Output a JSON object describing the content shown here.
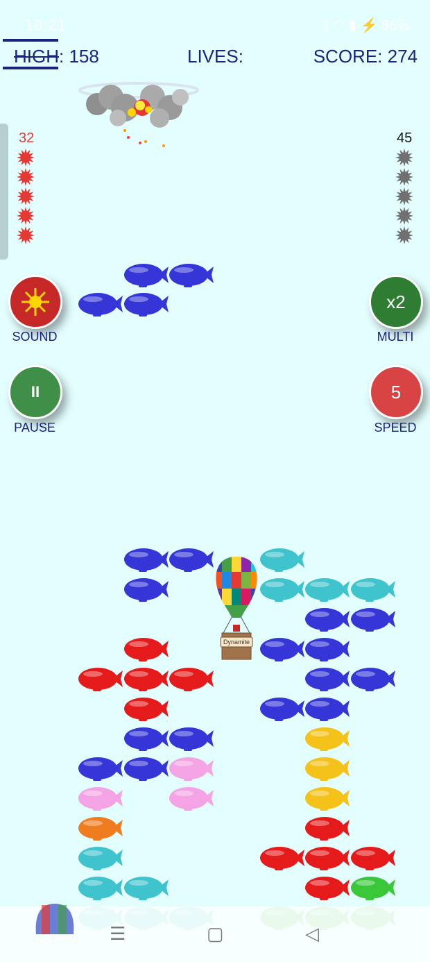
{
  "status_bar": {
    "time": "10:21",
    "battery": "86%"
  },
  "hud": {
    "high_label": "HIGH",
    "high_value": ": 158",
    "lives_label": "LIVES:",
    "score_label": "SCORE: 274"
  },
  "left_ammo": {
    "count": "32",
    "color": "#e53935"
  },
  "right_ammo": {
    "count": "45",
    "color": "#707070"
  },
  "buttons": {
    "sound": {
      "label": "SOUND",
      "color": "#c62828"
    },
    "multi": {
      "label": "MULTI",
      "text": "x2",
      "color": "#2e7d32"
    },
    "pause": {
      "label": "PAUSE",
      "text": "II",
      "color": "#3f8f48"
    },
    "speed": {
      "label": "SPEED",
      "text": "5",
      "color": "#d84343"
    }
  },
  "player": {
    "basket_label": "Dynamite"
  },
  "blimp_colors": {
    "blue": "#3535d8",
    "cyan": "#3fc3cc",
    "red": "#e51b1b",
    "pink": "#f4a3e4",
    "orange": "#f07c20",
    "yellow": "#f4c218",
    "green": "#3ac83a"
  },
  "grid_cols": [
    "c1",
    "c2",
    "c3",
    "c4",
    "c5",
    "c6",
    "c7"
  ],
  "blimps": [
    {
      "color": "blue",
      "col": 2,
      "row": 0,
      "zone": "top"
    },
    {
      "color": "blue",
      "col": 3,
      "row": 0,
      "zone": "top"
    },
    {
      "color": "blue",
      "col": 1,
      "row": 1,
      "zone": "top"
    },
    {
      "color": "blue",
      "col": 2,
      "row": 1,
      "zone": "top"
    },
    {
      "color": "blue",
      "col": 2,
      "row": 0
    },
    {
      "color": "blue",
      "col": 3,
      "row": 0
    },
    {
      "color": "cyan",
      "col": 5,
      "row": 0
    },
    {
      "color": "blue",
      "col": 2,
      "row": 1
    },
    {
      "color": "cyan",
      "col": 5,
      "row": 1
    },
    {
      "color": "cyan",
      "col": 6,
      "row": 1
    },
    {
      "color": "cyan",
      "col": 7,
      "row": 1
    },
    {
      "color": "blue",
      "col": 6,
      "row": 2
    },
    {
      "color": "blue",
      "col": 7,
      "row": 2
    },
    {
      "color": "red",
      "col": 2,
      "row": 3
    },
    {
      "color": "blue",
      "col": 5,
      "row": 3
    },
    {
      "color": "blue",
      "col": 6,
      "row": 3
    },
    {
      "color": "red",
      "col": 1,
      "row": 4
    },
    {
      "color": "red",
      "col": 2,
      "row": 4
    },
    {
      "color": "red",
      "col": 3,
      "row": 4
    },
    {
      "color": "blue",
      "col": 6,
      "row": 4
    },
    {
      "color": "blue",
      "col": 7,
      "row": 4
    },
    {
      "color": "red",
      "col": 2,
      "row": 5
    },
    {
      "color": "blue",
      "col": 5,
      "row": 5
    },
    {
      "color": "blue",
      "col": 6,
      "row": 5
    },
    {
      "color": "blue",
      "col": 2,
      "row": 6
    },
    {
      "color": "blue",
      "col": 3,
      "row": 6
    },
    {
      "color": "yellow",
      "col": 6,
      "row": 6
    },
    {
      "color": "blue",
      "col": 1,
      "row": 7
    },
    {
      "color": "blue",
      "col": 2,
      "row": 7
    },
    {
      "color": "pink",
      "col": 3,
      "row": 7
    },
    {
      "color": "yellow",
      "col": 6,
      "row": 7
    },
    {
      "color": "pink",
      "col": 1,
      "row": 8
    },
    {
      "color": "pink",
      "col": 3,
      "row": 8
    },
    {
      "color": "yellow",
      "col": 6,
      "row": 8
    },
    {
      "color": "orange",
      "col": 1,
      "row": 9
    },
    {
      "color": "red",
      "col": 6,
      "row": 9
    },
    {
      "color": "cyan",
      "col": 1,
      "row": 10
    },
    {
      "color": "red",
      "col": 5,
      "row": 10
    },
    {
      "color": "red",
      "col": 6,
      "row": 10
    },
    {
      "color": "red",
      "col": 7,
      "row": 10
    },
    {
      "color": "cyan",
      "col": 1,
      "row": 11
    },
    {
      "color": "cyan",
      "col": 2,
      "row": 11
    },
    {
      "color": "red",
      "col": 6,
      "row": 11
    },
    {
      "color": "green",
      "col": 7,
      "row": 11
    },
    {
      "color": "cyan",
      "col": 1,
      "row": 12
    },
    {
      "color": "cyan",
      "col": 2,
      "row": 12
    },
    {
      "color": "cyan",
      "col": 3,
      "row": 12
    },
    {
      "color": "green",
      "col": 5,
      "row": 12
    },
    {
      "color": "green",
      "col": 6,
      "row": 12
    },
    {
      "color": "green",
      "col": 7,
      "row": 12
    }
  ]
}
